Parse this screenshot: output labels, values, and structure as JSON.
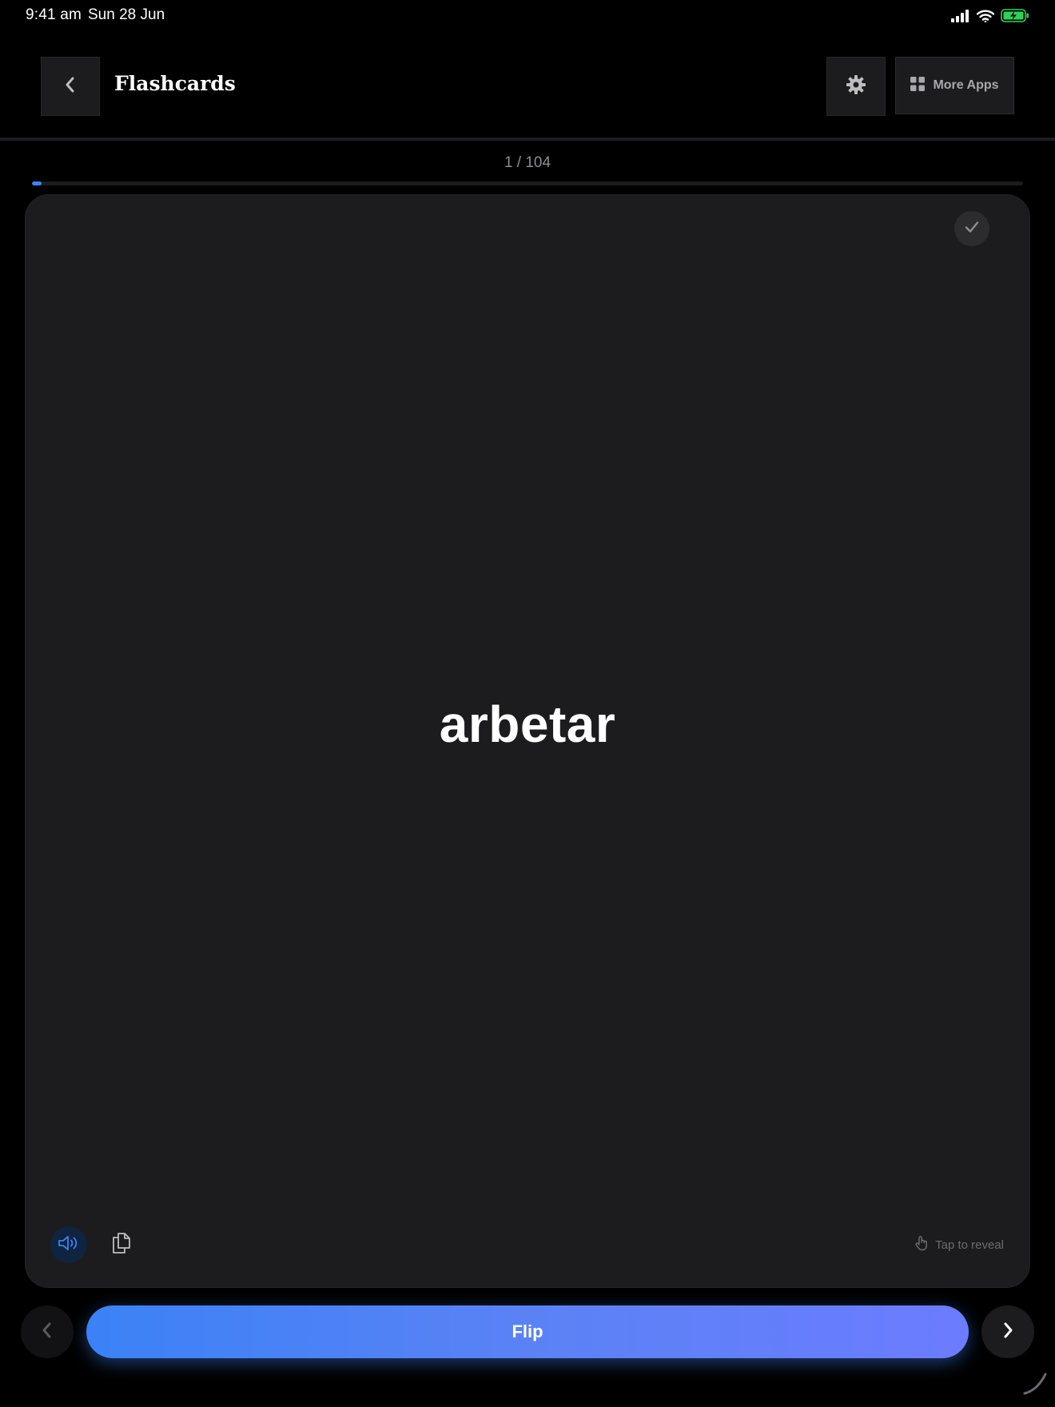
{
  "status_bar": {
    "time": "9:41 am",
    "date": "Sun 28 Jun",
    "icons": [
      "cellular-signal-icon",
      "wifi-icon",
      "battery-charging-icon"
    ],
    "battery_color": "#30d158"
  },
  "header": {
    "back_icon": "chevron-left-icon",
    "title": "Flashcards",
    "settings_icon": "gear-icon",
    "more_apps_icon": "grid-icon",
    "more_apps_label": "More Apps"
  },
  "progress": {
    "label": "1 / 104",
    "current": 1,
    "total": 104,
    "fraction": 0.0096,
    "accent_color": "#3b82f6"
  },
  "card": {
    "word": "arbetar",
    "known_icon": "checkmark-icon",
    "audio_icon": "speaker-icon",
    "copy_icon": "copy-icon",
    "tap_hint_icon": "hand-tap-icon",
    "tap_hint": "Tap to reveal"
  },
  "controls": {
    "prev_icon": "chevron-left-icon",
    "flip_label": "Flip",
    "next_icon": "chevron-right-icon"
  },
  "colors": {
    "background": "#000000",
    "card": "#1c1c1e",
    "accent_start": "#3b82f6",
    "accent_end": "#6c7cff"
  }
}
